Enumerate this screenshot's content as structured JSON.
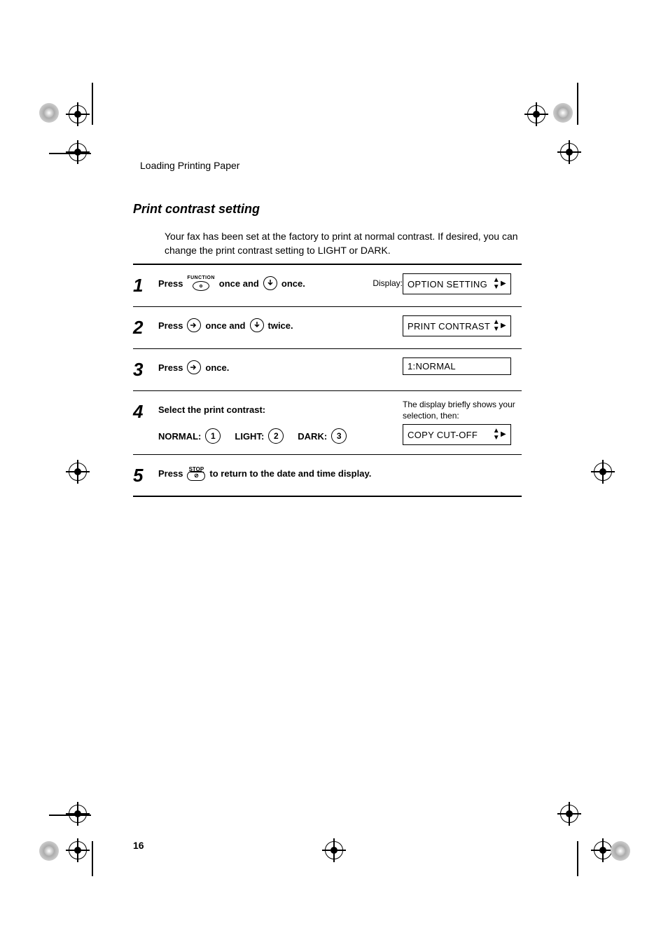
{
  "running_head": "Loading Printing Paper",
  "section_title": "Print contrast setting",
  "intro": "Your fax has been set at the factory to print at normal contrast. If desired, you can change the print contrast setting to LIGHT or DARK.",
  "display_label": "Display:",
  "steps": {
    "s1": {
      "num": "1",
      "press": "Press",
      "func_label": "FUNCTION",
      "mid": "once and",
      "end": "once.",
      "lcd": "OPTION SETTING"
    },
    "s2": {
      "num": "2",
      "press": "Press",
      "mid": "once and",
      "end": "twice.",
      "lcd": "PRINT CONTRAST"
    },
    "s3": {
      "num": "3",
      "press": "Press",
      "end": "once.",
      "lcd": "1:NORMAL"
    },
    "s4": {
      "num": "4",
      "title": "Select the print contrast:",
      "normal": "NORMAL:",
      "light": "LIGHT:",
      "dark": "DARK:",
      "k1": "1",
      "k2": "2",
      "k3": "3",
      "note": "The display briefly shows your selection, then:",
      "lcd": "COPY CUT-OFF"
    },
    "s5": {
      "num": "5",
      "press": "Press",
      "stop": "STOP",
      "end": "to return to the date and time display."
    }
  },
  "page_number": "16"
}
